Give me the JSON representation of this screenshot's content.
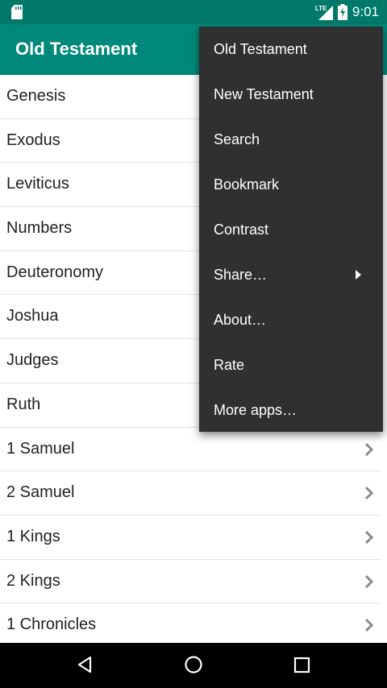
{
  "status_bar": {
    "time": "9:01",
    "network_label": "LTE",
    "icons": [
      "sd-card-icon",
      "signal-icon",
      "battery-charging-icon"
    ]
  },
  "app_bar": {
    "title": "Old Testament"
  },
  "books": [
    "Genesis",
    "Exodus",
    "Leviticus",
    "Numbers",
    "Deuteronomy",
    "Joshua",
    "Judges",
    "Ruth",
    "1 Samuel",
    "2 Samuel",
    "1 Kings",
    "2 Kings",
    "1 Chronicles"
  ],
  "overflow_menu": {
    "items": [
      {
        "label": "Old Testament"
      },
      {
        "label": "New Testament"
      },
      {
        "label": "Search"
      },
      {
        "label": "Bookmark"
      },
      {
        "label": "Contrast"
      },
      {
        "label": "Share…",
        "submenu": true
      },
      {
        "label": "About…"
      },
      {
        "label": "Rate"
      },
      {
        "label": "More apps…"
      }
    ]
  },
  "nav_bar": {
    "icons": [
      "back-icon",
      "home-icon",
      "recents-icon"
    ]
  },
  "colors": {
    "status_bar": "#00796b",
    "app_bar": "#00897b",
    "menu_bg": "#303030",
    "divider": "#e4e4e4"
  }
}
